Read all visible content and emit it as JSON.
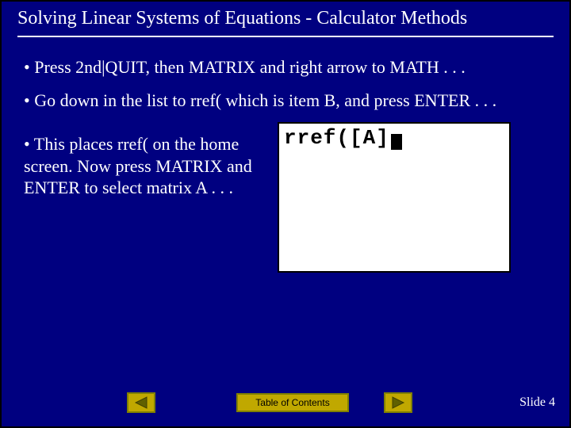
{
  "title": "Solving Linear Systems of Equations - Calculator Methods",
  "bullets": {
    "b1": "•  Press 2nd|QUIT, then MATRIX and right arrow to MATH . . .",
    "b2": "•  Go down in the list to rref( which is item B, and press ENTER . . .",
    "b3": "•  This places rref( on the home screen.  Now press MATRIX and ENTER to select matrix A . . ."
  },
  "calc": {
    "line1": "rref([A]"
  },
  "footer": {
    "toc_label": "Table of Contents",
    "slide_label": "Slide 4"
  }
}
